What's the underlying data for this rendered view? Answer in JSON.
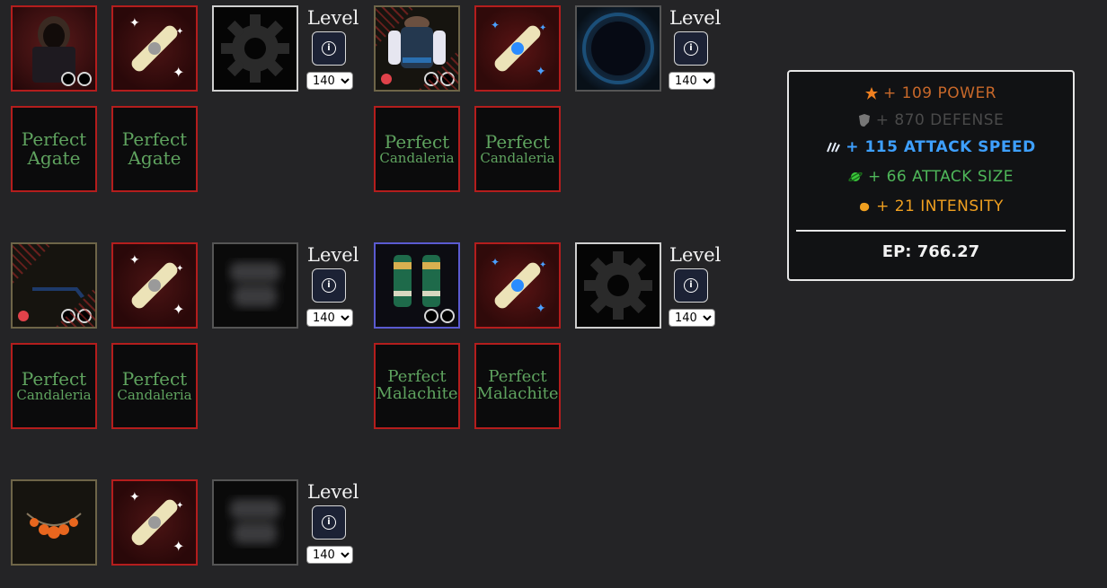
{
  "level_label": "Level",
  "level_options": [
    "140"
  ],
  "gear_rows": [
    {
      "left": {
        "level": "140",
        "gems": [
          {
            "line1": "Perfect",
            "line2": "Agate"
          },
          {
            "line1": "Perfect",
            "line2": "Agate"
          }
        ]
      },
      "right": {
        "level": "140",
        "gems": [
          {
            "line1": "Perfect",
            "line2": "Candaleria"
          },
          {
            "line1": "Perfect",
            "line2": "Candaleria"
          }
        ]
      }
    },
    {
      "left": {
        "level": "140",
        "gems": [
          {
            "line1": "Perfect",
            "line2": "Candaleria"
          },
          {
            "line1": "Perfect",
            "line2": "Candaleria"
          }
        ]
      },
      "right": {
        "level": "140",
        "gems": [
          {
            "line1": "Perfect",
            "line2": "Malachite"
          },
          {
            "line1": "Perfect",
            "line2": "Malachite"
          }
        ]
      }
    },
    {
      "left": {
        "level": "140"
      }
    }
  ],
  "stats": {
    "power": {
      "text": "+ 109 POWER",
      "color": "#c8682a",
      "icon": "power-star-icon"
    },
    "defense": {
      "text": "+ 870 DEFENSE",
      "color": "#4a4a4a",
      "icon": "shield-icon"
    },
    "attack_speed": {
      "text": "+ 115 ATTACK SPEED",
      "color": "#3ea0ff",
      "icon": "attack-speed-icon"
    },
    "attack_size": {
      "text": "+ 66 ATTACK SIZE",
      "color": "#4fb85a",
      "icon": "attack-size-icon"
    },
    "intensity": {
      "text": "+ 21 INTENSITY",
      "color": "#f0a020",
      "icon": "intensity-icon"
    },
    "ep_label": "EP: 766.27"
  }
}
